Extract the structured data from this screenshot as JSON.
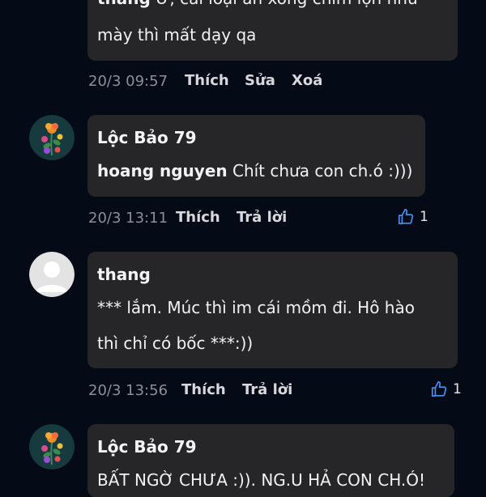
{
  "comments": [
    {
      "line1_author": "thang",
      "line1_rest": " Ừ, cái loại ăn xong chim lợn như",
      "line2": "mày thì mất dạy qa",
      "time": "20/3 09:57",
      "actions": [
        "Thích",
        "Sửa",
        "Xoá"
      ]
    },
    {
      "author": "Lộc Bảo 79",
      "mention": "hoang nguyen",
      "text": " Chít chưa con ch.ó :)))",
      "time": "20/3 13:11",
      "actions": [
        "Thích",
        "Trả lời"
      ],
      "likes": "1"
    },
    {
      "author": "thang",
      "line1": "*** lắm. Múc thì im cái mồm đi. Hô hào",
      "line2": "thì chỉ có bốc ***:))",
      "time": "20/3 13:56",
      "actions": [
        "Thích",
        "Trả lời"
      ],
      "likes": "1"
    },
    {
      "author": "Lộc Bảo 79",
      "line1": "BẤT NGỜ CHƯA :)). NG.U HẢ CON CH.Ó!"
    }
  ],
  "colors": {
    "background": "#050a17",
    "bubble": "#262629",
    "time": "#8d8f96",
    "action": "#d8d8dc"
  },
  "icons": {
    "like": "thumbs-up-icon",
    "avatar_flower": "flower-avatar-icon",
    "avatar_default": "default-user-avatar-icon"
  }
}
